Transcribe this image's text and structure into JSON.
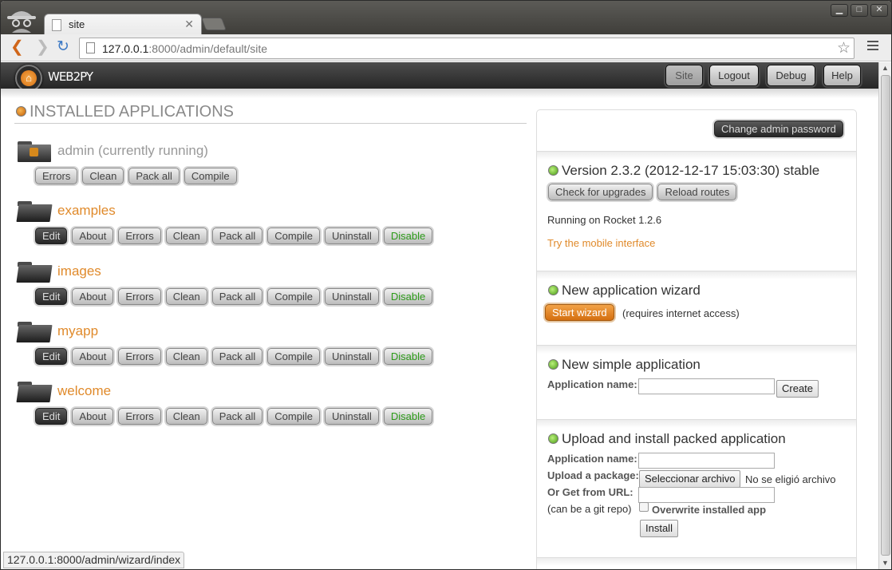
{
  "browser": {
    "tab_title": "site",
    "url_host": "127.0.0.1",
    "url_rest": ":8000/admin/default/site",
    "status_url": "127.0.0.1:8000/admin/wizard/index"
  },
  "nav": {
    "logo": "WEB2PY",
    "items": [
      "Site",
      "Logout",
      "Debug",
      "Help"
    ],
    "active": "Site"
  },
  "installed": {
    "heading": "INSTALLED APPLICATIONS",
    "admin": {
      "name": "admin (currently running)",
      "buttons": [
        "Errors",
        "Clean",
        "Pack all",
        "Compile"
      ]
    },
    "apps": [
      {
        "name": "examples"
      },
      {
        "name": "images"
      },
      {
        "name": "myapp"
      },
      {
        "name": "welcome"
      }
    ],
    "app_buttons": [
      "Edit",
      "About",
      "Errors",
      "Clean",
      "Pack all",
      "Compile",
      "Uninstall",
      "Disable"
    ]
  },
  "sidebar": {
    "change_password": "Change admin password",
    "version": {
      "title": "Version 2.3.2 (2012-12-17 15:03:30) stable",
      "check": "Check for upgrades",
      "reload": "Reload routes",
      "running": "Running on Rocket 1.2.6",
      "mobile": "Try the mobile interface"
    },
    "wizard": {
      "title": "New application wizard",
      "button": "Start wizard",
      "note": "(requires internet access)"
    },
    "simple": {
      "title": "New simple application",
      "label": "Application name:",
      "button": "Create"
    },
    "upload": {
      "title": "Upload and install packed application",
      "name_label": "Application name:",
      "package_label": "Upload a package:",
      "file_button": "Seleccionar archivo",
      "file_none": "No se eligió archivo",
      "url_label": "Or Get from URL:",
      "git_note": "(can be a git repo)",
      "overwrite": "Overwrite installed app",
      "install": "Install"
    }
  },
  "colors": {
    "accent": "#e08a2b",
    "green": "#2d9b1a",
    "navbar": "#262626"
  }
}
